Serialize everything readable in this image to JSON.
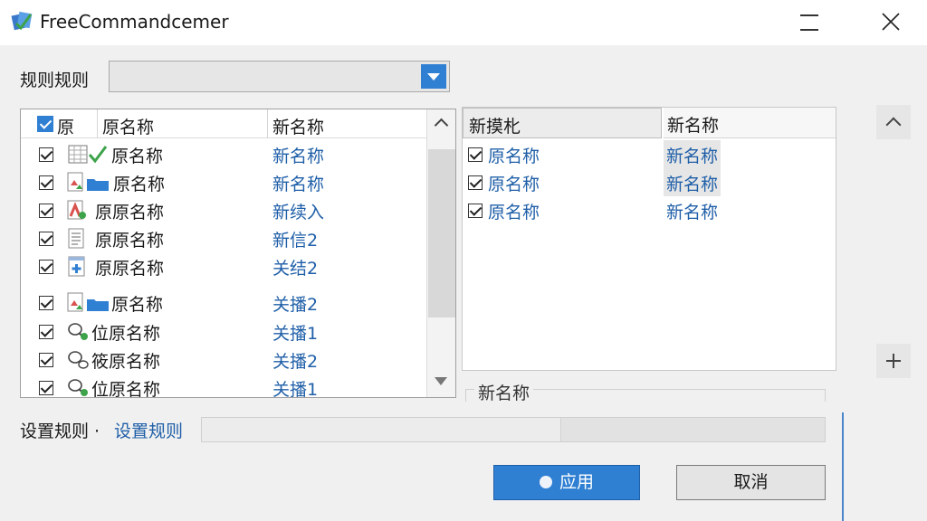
{
  "window": {
    "title": "FreeCommandcemer"
  },
  "rule": {
    "label": "规则规则",
    "combo_value": ""
  },
  "left_list": {
    "headers": {
      "col1": "原",
      "col2": "原名称",
      "col3": "新名称"
    },
    "rows": [
      {
        "icon": "calendar-check-icon",
        "original": "原名称",
        "new": "新名称",
        "checked": true
      },
      {
        "icon": "image-folder-icon",
        "original": "原名称",
        "new": "新名称",
        "checked": true
      },
      {
        "icon": "red-document-icon",
        "original": "原原名称",
        "new": "新续入",
        "checked": true
      },
      {
        "icon": "text-document-icon",
        "original": "原原名称",
        "new": "新信2",
        "checked": true
      },
      {
        "icon": "medical-document-icon",
        "original": "原原名称",
        "new": "关结2",
        "checked": true
      },
      {
        "icon": "image-folder-icon",
        "original": "原名称",
        "new": "关播2",
        "checked": true
      },
      {
        "icon": "key-icon",
        "original": "位原名称",
        "new": "关播1",
        "checked": true
      },
      {
        "icon": "key-icon",
        "original": "筱原名称",
        "new": "关播2",
        "checked": true
      },
      {
        "icon": "key-icon",
        "original": "位原名称",
        "new": "关播1",
        "checked": true
      }
    ]
  },
  "right_list": {
    "headers": {
      "col1": "新摸朼",
      "col2": "新名称"
    },
    "rows": [
      {
        "original": "原名称",
        "new": "新名称",
        "checked": true
      },
      {
        "original": "原名称",
        "new": "新名称",
        "checked": true
      },
      {
        "original": "原名称",
        "new": "新名称",
        "checked": true
      }
    ],
    "group_label": "新名称"
  },
  "settings": {
    "label": "设置规则 ·",
    "link": "设置规则",
    "value": ""
  },
  "buttons": {
    "apply": "应用",
    "cancel": "取消"
  },
  "colors": {
    "accent": "#2f7fd3",
    "link_text": "#1f5fa8",
    "background": "#f0f0f0"
  }
}
